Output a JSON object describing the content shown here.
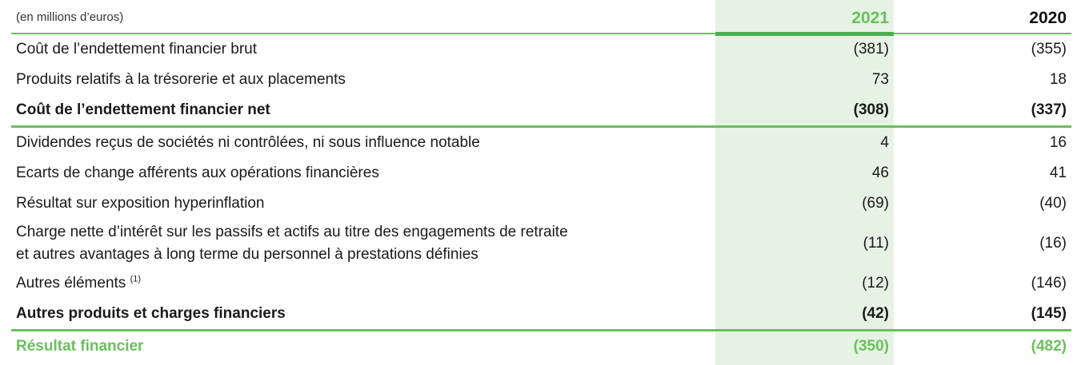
{
  "table": {
    "unit_note": "(en millions d’euros)",
    "col_2021": "2021",
    "col_2020": "2020",
    "rows": [
      {
        "label": "Coût de l’endettement financier brut",
        "v2021": "(381)",
        "v2020": "(355)"
      },
      {
        "label": "Produits relatifs à la trésorerie et aux placements",
        "v2021": "73",
        "v2020": "18"
      },
      {
        "label": "Coût de l’endettement financier net",
        "v2021": "(308)",
        "v2020": "(337)"
      },
      {
        "label": "Dividendes reçus de sociétés ni contrôlées, ni sous influence notable",
        "v2021": "4",
        "v2020": "16"
      },
      {
        "label": "Ecarts de change afférents aux opérations financières",
        "v2021": "46",
        "v2020": "41"
      },
      {
        "label": "Résultat sur exposition hyperinflation",
        "v2021": "(69)",
        "v2020": "(40)"
      },
      {
        "label_line1": "Charge nette d’intérêt sur les passifs et actifs au titre des engagements de retraite",
        "label_line2": "et autres avantages à long terme du personnel à prestations définies",
        "v2021": "(11)",
        "v2020": "(16)"
      },
      {
        "label": "Autres éléments",
        "note": "(1)",
        "v2021": "(12)",
        "v2020": "(146)"
      },
      {
        "label": "Autres produits et charges financiers",
        "v2021": "(42)",
        "v2020": "(145)"
      },
      {
        "label": "Résultat financier",
        "v2021": "(350)",
        "v2020": "(482)"
      }
    ]
  },
  "colors": {
    "accent_green": "#6bbf5d",
    "highlight_bg": "#e6f2e4"
  }
}
